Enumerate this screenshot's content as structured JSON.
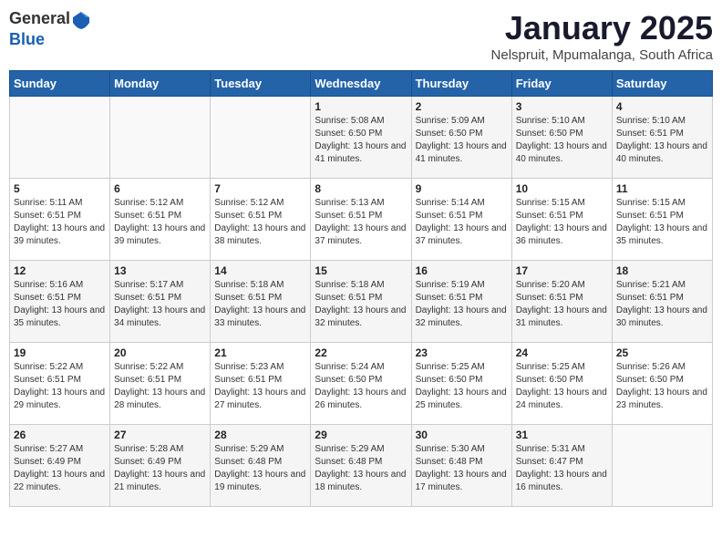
{
  "logo": {
    "general": "General",
    "blue": "Blue"
  },
  "header": {
    "title": "January 2025",
    "subtitle": "Nelspruit, Mpumalanga, South Africa"
  },
  "days_of_week": [
    "Sunday",
    "Monday",
    "Tuesday",
    "Wednesday",
    "Thursday",
    "Friday",
    "Saturday"
  ],
  "weeks": [
    {
      "days": [
        {
          "num": "",
          "sunrise": "",
          "sunset": "",
          "daylight": ""
        },
        {
          "num": "",
          "sunrise": "",
          "sunset": "",
          "daylight": ""
        },
        {
          "num": "",
          "sunrise": "",
          "sunset": "",
          "daylight": ""
        },
        {
          "num": "1",
          "sunrise": "Sunrise: 5:08 AM",
          "sunset": "Sunset: 6:50 PM",
          "daylight": "Daylight: 13 hours and 41 minutes."
        },
        {
          "num": "2",
          "sunrise": "Sunrise: 5:09 AM",
          "sunset": "Sunset: 6:50 PM",
          "daylight": "Daylight: 13 hours and 41 minutes."
        },
        {
          "num": "3",
          "sunrise": "Sunrise: 5:10 AM",
          "sunset": "Sunset: 6:50 PM",
          "daylight": "Daylight: 13 hours and 40 minutes."
        },
        {
          "num": "4",
          "sunrise": "Sunrise: 5:10 AM",
          "sunset": "Sunset: 6:51 PM",
          "daylight": "Daylight: 13 hours and 40 minutes."
        }
      ]
    },
    {
      "days": [
        {
          "num": "5",
          "sunrise": "Sunrise: 5:11 AM",
          "sunset": "Sunset: 6:51 PM",
          "daylight": "Daylight: 13 hours and 39 minutes."
        },
        {
          "num": "6",
          "sunrise": "Sunrise: 5:12 AM",
          "sunset": "Sunset: 6:51 PM",
          "daylight": "Daylight: 13 hours and 39 minutes."
        },
        {
          "num": "7",
          "sunrise": "Sunrise: 5:12 AM",
          "sunset": "Sunset: 6:51 PM",
          "daylight": "Daylight: 13 hours and 38 minutes."
        },
        {
          "num": "8",
          "sunrise": "Sunrise: 5:13 AM",
          "sunset": "Sunset: 6:51 PM",
          "daylight": "Daylight: 13 hours and 37 minutes."
        },
        {
          "num": "9",
          "sunrise": "Sunrise: 5:14 AM",
          "sunset": "Sunset: 6:51 PM",
          "daylight": "Daylight: 13 hours and 37 minutes."
        },
        {
          "num": "10",
          "sunrise": "Sunrise: 5:15 AM",
          "sunset": "Sunset: 6:51 PM",
          "daylight": "Daylight: 13 hours and 36 minutes."
        },
        {
          "num": "11",
          "sunrise": "Sunrise: 5:15 AM",
          "sunset": "Sunset: 6:51 PM",
          "daylight": "Daylight: 13 hours and 35 minutes."
        }
      ]
    },
    {
      "days": [
        {
          "num": "12",
          "sunrise": "Sunrise: 5:16 AM",
          "sunset": "Sunset: 6:51 PM",
          "daylight": "Daylight: 13 hours and 35 minutes."
        },
        {
          "num": "13",
          "sunrise": "Sunrise: 5:17 AM",
          "sunset": "Sunset: 6:51 PM",
          "daylight": "Daylight: 13 hours and 34 minutes."
        },
        {
          "num": "14",
          "sunrise": "Sunrise: 5:18 AM",
          "sunset": "Sunset: 6:51 PM",
          "daylight": "Daylight: 13 hours and 33 minutes."
        },
        {
          "num": "15",
          "sunrise": "Sunrise: 5:18 AM",
          "sunset": "Sunset: 6:51 PM",
          "daylight": "Daylight: 13 hours and 32 minutes."
        },
        {
          "num": "16",
          "sunrise": "Sunrise: 5:19 AM",
          "sunset": "Sunset: 6:51 PM",
          "daylight": "Daylight: 13 hours and 32 minutes."
        },
        {
          "num": "17",
          "sunrise": "Sunrise: 5:20 AM",
          "sunset": "Sunset: 6:51 PM",
          "daylight": "Daylight: 13 hours and 31 minutes."
        },
        {
          "num": "18",
          "sunrise": "Sunrise: 5:21 AM",
          "sunset": "Sunset: 6:51 PM",
          "daylight": "Daylight: 13 hours and 30 minutes."
        }
      ]
    },
    {
      "days": [
        {
          "num": "19",
          "sunrise": "Sunrise: 5:22 AM",
          "sunset": "Sunset: 6:51 PM",
          "daylight": "Daylight: 13 hours and 29 minutes."
        },
        {
          "num": "20",
          "sunrise": "Sunrise: 5:22 AM",
          "sunset": "Sunset: 6:51 PM",
          "daylight": "Daylight: 13 hours and 28 minutes."
        },
        {
          "num": "21",
          "sunrise": "Sunrise: 5:23 AM",
          "sunset": "Sunset: 6:51 PM",
          "daylight": "Daylight: 13 hours and 27 minutes."
        },
        {
          "num": "22",
          "sunrise": "Sunrise: 5:24 AM",
          "sunset": "Sunset: 6:50 PM",
          "daylight": "Daylight: 13 hours and 26 minutes."
        },
        {
          "num": "23",
          "sunrise": "Sunrise: 5:25 AM",
          "sunset": "Sunset: 6:50 PM",
          "daylight": "Daylight: 13 hours and 25 minutes."
        },
        {
          "num": "24",
          "sunrise": "Sunrise: 5:25 AM",
          "sunset": "Sunset: 6:50 PM",
          "daylight": "Daylight: 13 hours and 24 minutes."
        },
        {
          "num": "25",
          "sunrise": "Sunrise: 5:26 AM",
          "sunset": "Sunset: 6:50 PM",
          "daylight": "Daylight: 13 hours and 23 minutes."
        }
      ]
    },
    {
      "days": [
        {
          "num": "26",
          "sunrise": "Sunrise: 5:27 AM",
          "sunset": "Sunset: 6:49 PM",
          "daylight": "Daylight: 13 hours and 22 minutes."
        },
        {
          "num": "27",
          "sunrise": "Sunrise: 5:28 AM",
          "sunset": "Sunset: 6:49 PM",
          "daylight": "Daylight: 13 hours and 21 minutes."
        },
        {
          "num": "28",
          "sunrise": "Sunrise: 5:29 AM",
          "sunset": "Sunset: 6:48 PM",
          "daylight": "Daylight: 13 hours and 19 minutes."
        },
        {
          "num": "29",
          "sunrise": "Sunrise: 5:29 AM",
          "sunset": "Sunset: 6:48 PM",
          "daylight": "Daylight: 13 hours and 18 minutes."
        },
        {
          "num": "30",
          "sunrise": "Sunrise: 5:30 AM",
          "sunset": "Sunset: 6:48 PM",
          "daylight": "Daylight: 13 hours and 17 minutes."
        },
        {
          "num": "31",
          "sunrise": "Sunrise: 5:31 AM",
          "sunset": "Sunset: 6:47 PM",
          "daylight": "Daylight: 13 hours and 16 minutes."
        },
        {
          "num": "",
          "sunrise": "",
          "sunset": "",
          "daylight": ""
        }
      ]
    }
  ]
}
